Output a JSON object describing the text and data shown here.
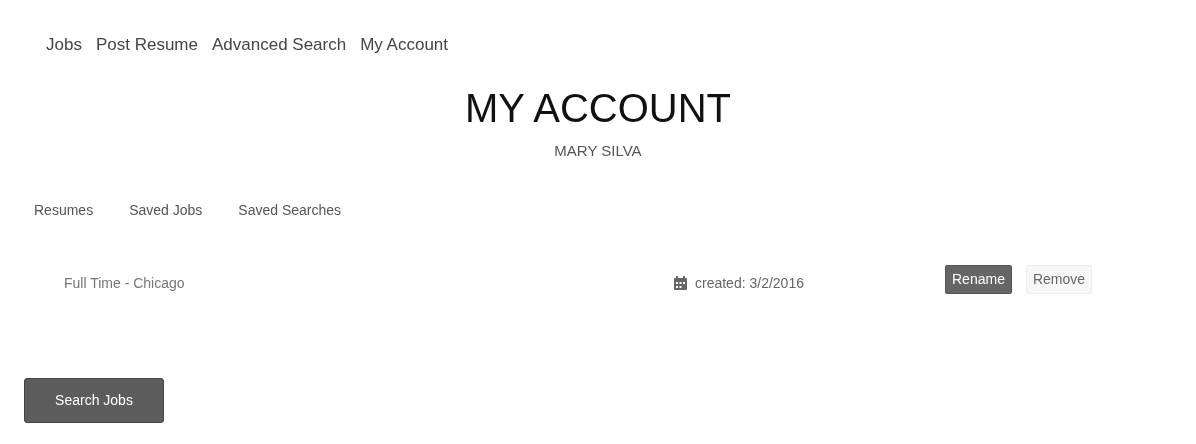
{
  "nav": [
    "Jobs",
    "Post Resume",
    "Advanced Search",
    "My Account"
  ],
  "title": "MY ACCOUNT",
  "subtitle": "MARY SILVA",
  "tabs": [
    "Resumes",
    "Saved Jobs",
    "Saved Searches"
  ],
  "saved_searches": [
    {
      "name": "Full Time - Chicago",
      "created": "created: 3/2/2016",
      "buttons": [
        "Rename",
        "Remove"
      ]
    }
  ],
  "search_button": "Search Jobs"
}
